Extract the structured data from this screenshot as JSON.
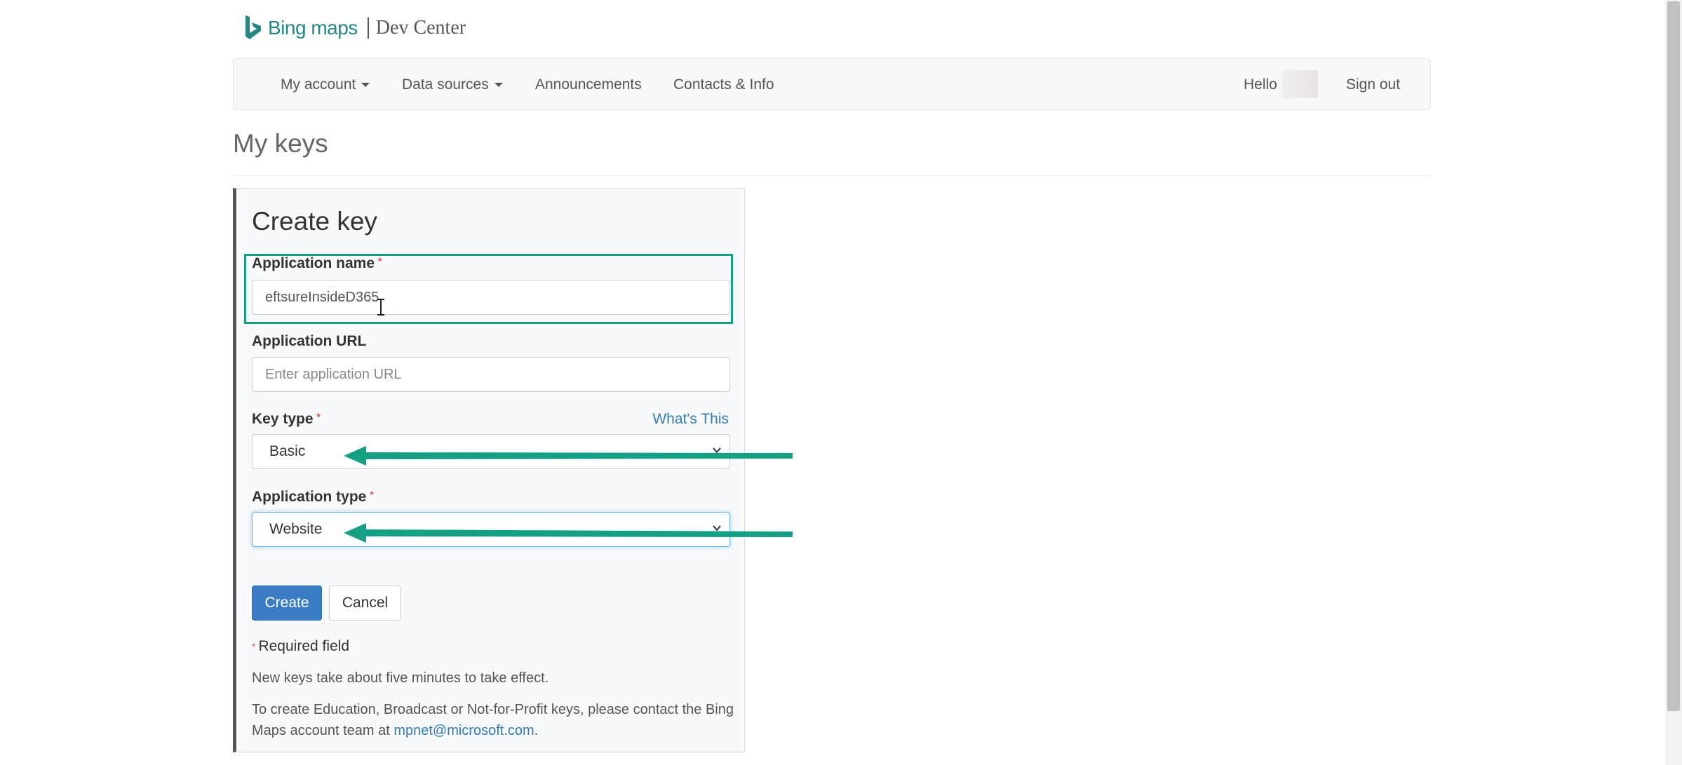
{
  "brand": {
    "bing": "Bing maps",
    "product": "Dev Center",
    "color": "#258686"
  },
  "nav": {
    "my_account": "My account",
    "data_sources": "Data sources",
    "announcements": "Announcements",
    "contacts": "Contacts & Info",
    "hello": "Hello",
    "sign_out": "Sign out"
  },
  "page": {
    "title": "My keys"
  },
  "form": {
    "heading": "Create key",
    "app_name_label": "Application name",
    "app_name_value": "eftsureInsideD365",
    "app_url_label": "Application URL",
    "app_url_placeholder": "Enter application URL",
    "key_type_label": "Key type",
    "whats_this": "What's This",
    "key_type_value": "Basic",
    "app_type_label": "Application type",
    "app_type_value": "Website",
    "required_marker": "*",
    "create_label": "Create",
    "cancel_label": "Cancel",
    "required_note": "Required field",
    "note_1": "New keys take about five minutes to take effect.",
    "note_2": "To create Education, Broadcast or Not-for-Profit keys, please contact the Bing Maps account team at",
    "email": "mpnet@microsoft.com",
    "period": "."
  },
  "colors": {
    "primary_button": "#3b7dc4",
    "annotation": "#13a085",
    "link": "#337ab7",
    "required": "#d9534f"
  }
}
